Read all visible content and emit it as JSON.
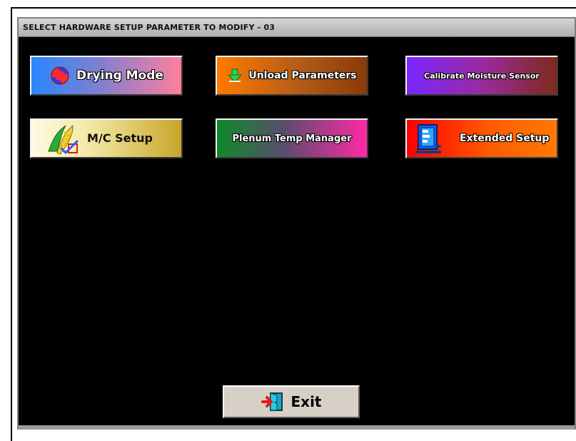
{
  "window": {
    "title": "SELECT HARDWARE SETUP PARAMETER TO MODIFY - 03"
  },
  "buttons": {
    "drying_mode": {
      "label": "Drying Mode",
      "icon": "refresh-icon"
    },
    "unload_parameters": {
      "label": "Unload Parameters",
      "icon": "down-arrow-icon"
    },
    "calibrate_moisture_sensor": {
      "label": "Calibrate Moisture Sensor"
    },
    "mc_setup": {
      "label": "M/C Setup",
      "icon": "corn-icon"
    },
    "plenum_temp_manager": {
      "label": "Plenum Temp Manager"
    },
    "extended_setup": {
      "label": "Extended Setup",
      "icon": "panel-icon"
    },
    "exit": {
      "label": "Exit",
      "icon": "exit-door-icon"
    }
  },
  "colors": {
    "background": "#000000",
    "titlebar": "#c6c6c6",
    "exit_button": "#d6d0c6"
  }
}
